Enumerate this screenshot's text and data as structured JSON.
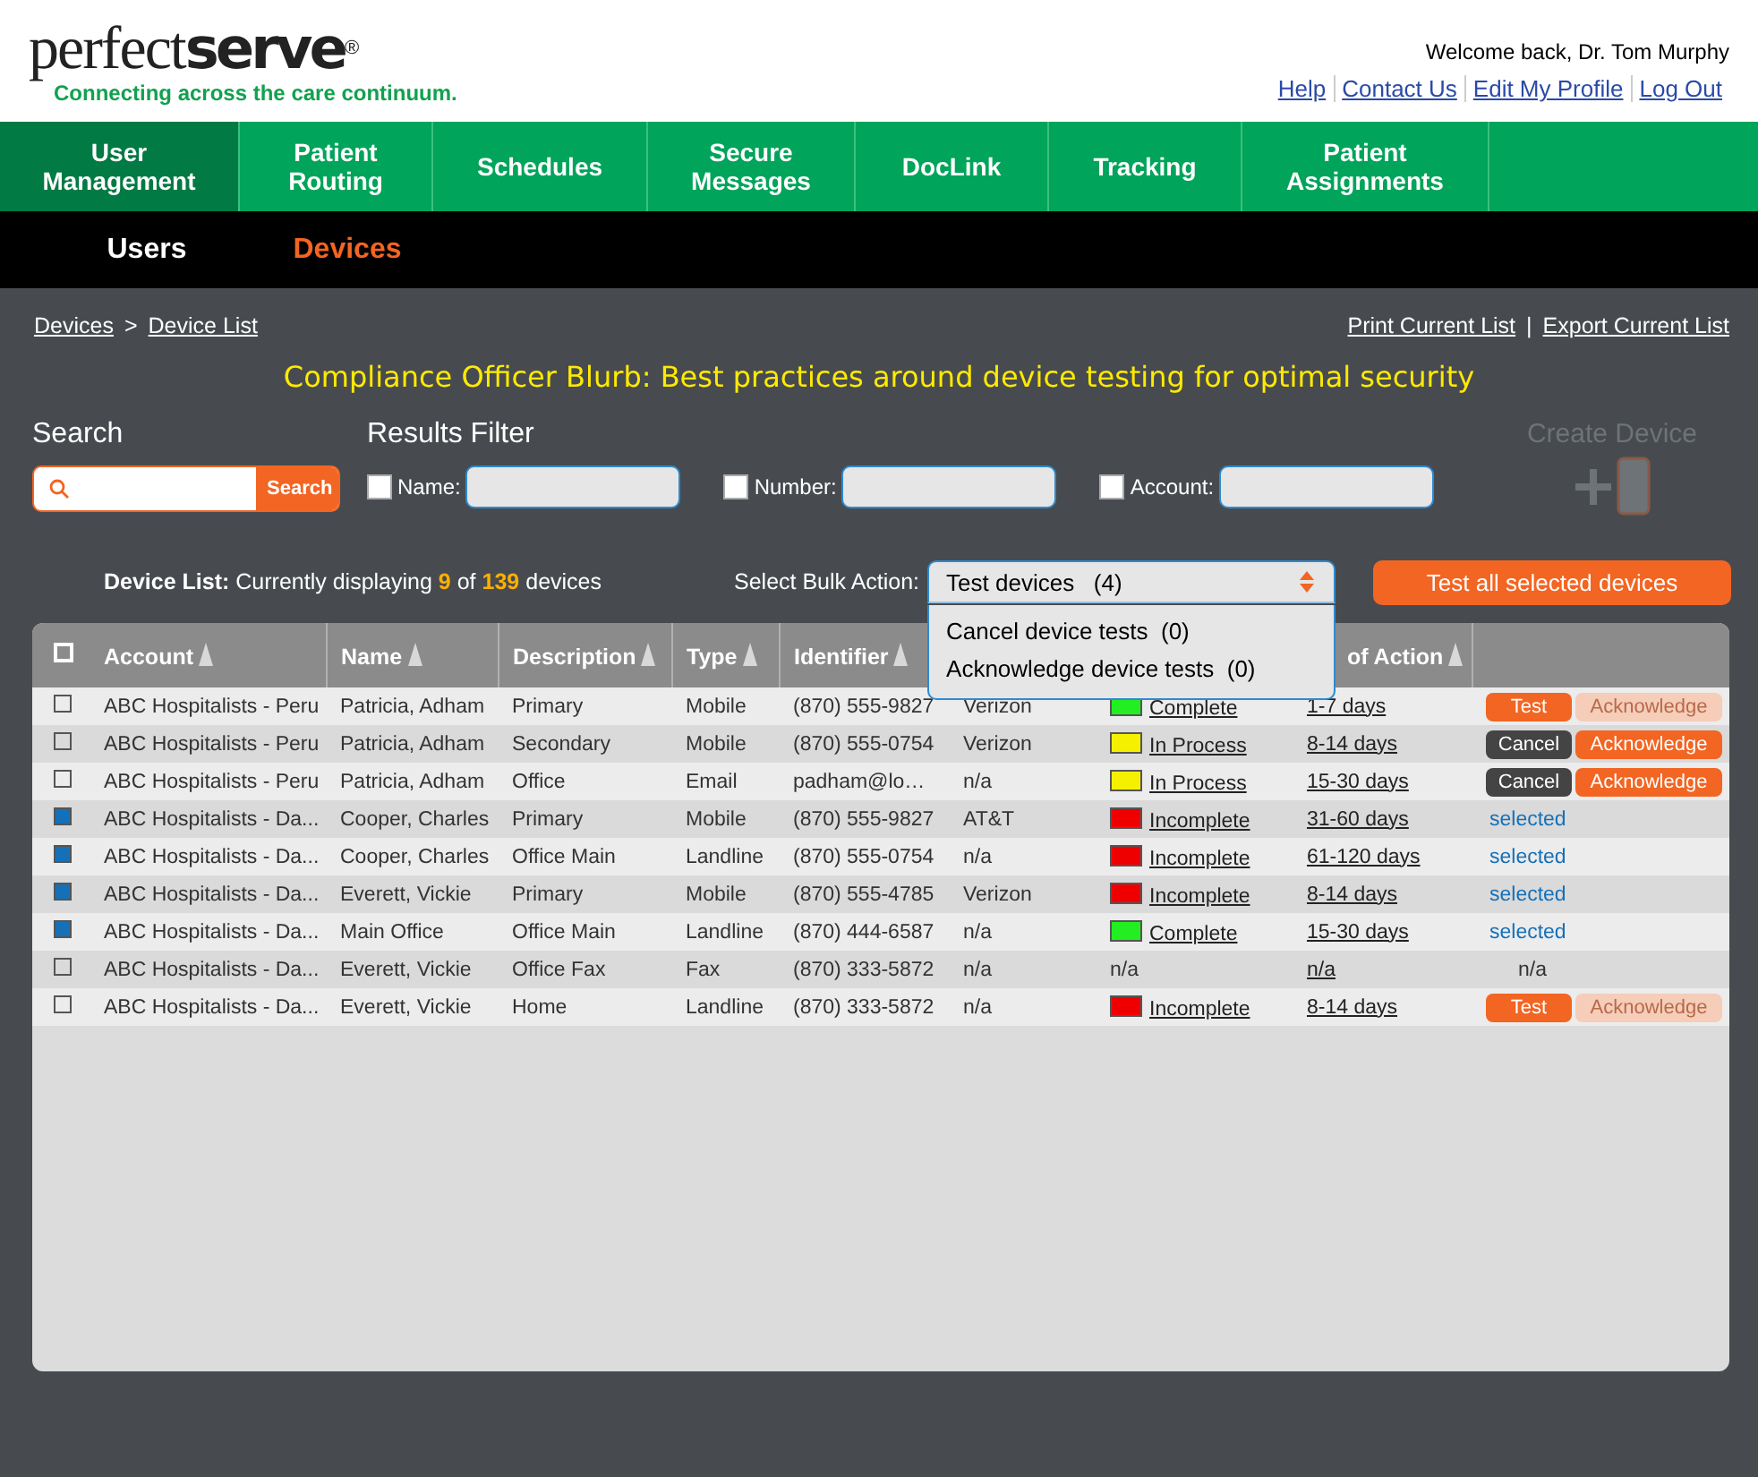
{
  "logo": {
    "light": "perfect",
    "bold": "serve",
    "mark": "®",
    "tagline": "Connecting across the care continuum."
  },
  "user": {
    "welcome": "Welcome back, Dr. Tom Murphy",
    "links": [
      "Help",
      "Contact Us",
      "Edit My Profile",
      "Log Out"
    ]
  },
  "nav": [
    {
      "label": "User Management",
      "selected": true
    },
    {
      "label": "Patient Routing",
      "selected": false
    },
    {
      "label": "Schedules",
      "selected": false
    },
    {
      "label": "Secure Messages",
      "selected": false
    },
    {
      "label": "DocLink",
      "selected": false
    },
    {
      "label": "Tracking",
      "selected": false
    },
    {
      "label": "Patient Assignments",
      "selected": false
    }
  ],
  "subnav": [
    {
      "label": "Users",
      "selected": false
    },
    {
      "label": "Devices",
      "selected": true
    }
  ],
  "breadcrumb": {
    "items": [
      "Devices",
      "Device List"
    ],
    "separator": ">"
  },
  "list_links": {
    "items": [
      "Print Current List",
      "Export Current List"
    ],
    "separator": "|"
  },
  "blurb": "Compliance Officer Blurb: Best practices around device testing for optimal security",
  "search": {
    "title": "Search",
    "button": "Search"
  },
  "filters": {
    "title": "Results Filter",
    "fields": [
      {
        "label": "Name:",
        "checked": false
      },
      {
        "label": "Number:",
        "checked": false
      },
      {
        "label": "Account:",
        "checked": false
      }
    ]
  },
  "create": {
    "label": "Create Device",
    "disabled": true
  },
  "summary": {
    "label": "Device List:",
    "text": "Currently displaying",
    "shown": "9",
    "of": "of",
    "total": "139",
    "unit": "devices"
  },
  "bulk": {
    "label": "Select Bulk Action:",
    "value": "Test devices",
    "count": "(4)",
    "expanded": true,
    "options": [
      {
        "label": "Cancel device tests",
        "count": "(0)"
      },
      {
        "label": "Acknowledge device tests",
        "count": "(0)"
      }
    ]
  },
  "test_all": "Test all selected devices",
  "table": {
    "all_selected": false,
    "columns": [
      "Account",
      "Name",
      "Description",
      "Type",
      "Identifier",
      "",
      "",
      "of Action",
      ""
    ],
    "rows": [
      {
        "selected": false,
        "cells": [
          "ABC Hospitalists - Peru",
          "Patricia, Adham",
          "Primary",
          "Mobile",
          "(870) 555-9827",
          "Verizon"
        ],
        "status": {
          "label": "Complete",
          "color": "#22ee22"
        },
        "time": "1-7 days",
        "actions": [
          {
            "kind": "test",
            "label": "Test",
            "disabled": false
          },
          {
            "kind": "acknowledge",
            "label": "Acknowledge",
            "disabled": true
          }
        ]
      },
      {
        "selected": false,
        "cells": [
          "ABC Hospitalists - Peru",
          "Patricia, Adham",
          "Secondary",
          "Mobile",
          "(870) 555-0754",
          "Verizon"
        ],
        "status": {
          "label": "In Process",
          "color": "#f5f000"
        },
        "time": "8-14 days",
        "actions": [
          {
            "kind": "cancel",
            "label": "Cancel",
            "disabled": false
          },
          {
            "kind": "acknowledge",
            "label": "Acknowledge",
            "disabled": false
          }
        ]
      },
      {
        "selected": false,
        "cells": [
          "ABC Hospitalists - Peru",
          "Patricia, Adham",
          "Office",
          "Email",
          "padham@lo…",
          "n/a"
        ],
        "status": {
          "label": "In Process",
          "color": "#f5f000"
        },
        "time": "15-30 days",
        "actions": [
          {
            "kind": "cancel",
            "label": "Cancel",
            "disabled": false
          },
          {
            "kind": "acknowledge",
            "label": "Acknowledge",
            "disabled": false
          }
        ]
      },
      {
        "selected": true,
        "cells": [
          "ABC Hospitalists - Da...",
          "Cooper, Charles",
          "Primary",
          "Mobile",
          "(870) 555-9827",
          "AT&T"
        ],
        "status": {
          "label": "Incomplete",
          "color": "#ee0000"
        },
        "time": "31-60 days",
        "actions": [
          {
            "kind": "link",
            "label": "selected"
          }
        ]
      },
      {
        "selected": true,
        "cells": [
          "ABC Hospitalists - Da...",
          "Cooper, Charles",
          "Office Main",
          "Landline",
          "(870) 555-0754",
          "n/a"
        ],
        "status": {
          "label": "Incomplete",
          "color": "#ee0000"
        },
        "time": "61-120 days",
        "actions": [
          {
            "kind": "link",
            "label": "selected"
          }
        ]
      },
      {
        "selected": true,
        "cells": [
          "ABC Hospitalists - Da...",
          "Everett, Vickie",
          "Primary",
          "Mobile",
          "(870) 555-4785",
          "Verizon"
        ],
        "status": {
          "label": "Incomplete",
          "color": "#ee0000"
        },
        "time": "8-14 days",
        "actions": [
          {
            "kind": "link",
            "label": "selected"
          }
        ]
      },
      {
        "selected": true,
        "cells": [
          "ABC Hospitalists - Da...",
          "Main Office",
          "Office Main",
          "Landline",
          "(870) 444-6587",
          "n/a"
        ],
        "status": {
          "label": "Complete",
          "color": "#22ee22"
        },
        "time": "15-30 days",
        "actions": [
          {
            "kind": "link",
            "label": "selected"
          }
        ]
      },
      {
        "selected": false,
        "cells": [
          "ABC Hospitalists - Da...",
          "Everett, Vickie",
          "Office Fax",
          "Fax",
          "(870) 333-5872",
          "n/a"
        ],
        "status": {
          "label": "n/a"
        },
        "time": "n/a",
        "actions": [
          {
            "kind": "text",
            "label": "n/a"
          }
        ]
      },
      {
        "selected": false,
        "cells": [
          "ABC Hospitalists - Da...",
          "Everett, Vickie",
          "Home",
          "Landline",
          "(870) 333-5872",
          "n/a"
        ],
        "status": {
          "label": "Incomplete",
          "color": "#ee0000"
        },
        "time": "8-14 days",
        "actions": [
          {
            "kind": "test",
            "label": "Test",
            "disabled": false
          },
          {
            "kind": "acknowledge",
            "label": "Acknowledge",
            "disabled": true
          }
        ]
      }
    ]
  }
}
